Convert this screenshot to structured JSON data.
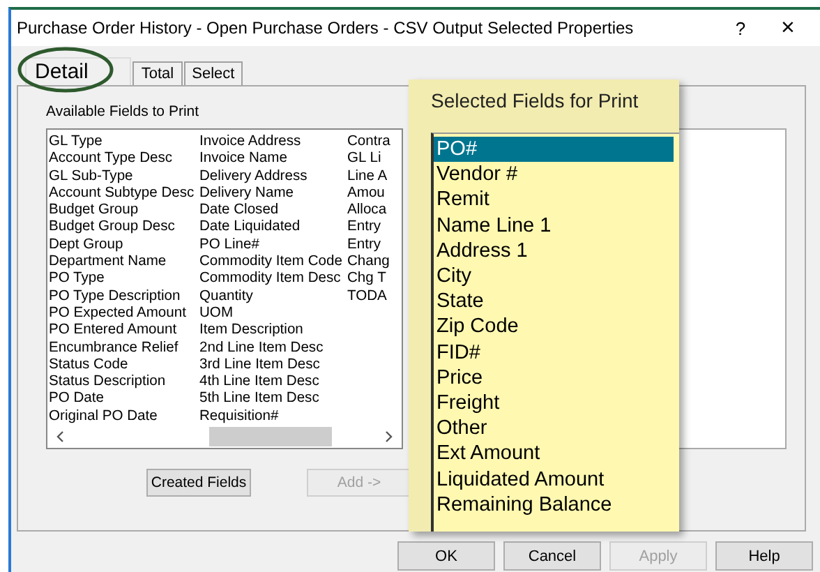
{
  "window": {
    "title": "Purchase Order History - Open Purchase Orders - CSV Output Selected Properties",
    "help_button": "?",
    "close_button": "×"
  },
  "tabs": [
    {
      "label": "Detail",
      "selected": true,
      "circled": true
    },
    {
      "label": "Total",
      "selected": false,
      "circled": false
    },
    {
      "label": "Select",
      "selected": false,
      "circled": false
    }
  ],
  "available_fields": {
    "label": "Available Fields to Print",
    "columns": [
      [
        "GL Type",
        "Account Type Desc",
        "GL Sub-Type",
        "Account Subtype Desc",
        "Budget Group",
        "Budget Group Desc",
        "Dept Group",
        "Department Name",
        "PO Type",
        "PO Type Description",
        "PO Expected Amount",
        "PO Entered Amount",
        "Encumbrance Relief",
        "Status Code",
        "Status Description",
        "PO Date",
        "Original PO Date"
      ],
      [
        "Invoice Address",
        "Invoice Name",
        "Delivery Address",
        "Delivery Name",
        "Date Closed",
        "Date Liquidated",
        "PO Line#",
        "Commodity Item Code",
        "Commodity Item Desc",
        "Quantity",
        "UOM",
        "Item Description",
        "2nd Line Item Desc",
        "3rd Line Item Desc",
        "4th Line Item Desc",
        "5th Line Item Desc",
        "Requisition#"
      ],
      [
        "Contra",
        "GL Li",
        "Line A",
        "Amou",
        "Alloca",
        "Entry",
        "Entry",
        "Chang",
        "Chg T",
        "TODA"
      ]
    ]
  },
  "selected_fields": {
    "title": "Selected Fields for Print",
    "items": [
      {
        "label": "PO#",
        "selected": true
      },
      {
        "label": "Vendor #",
        "selected": false
      },
      {
        "label": "Remit",
        "selected": false
      },
      {
        "label": "Name Line 1",
        "selected": false
      },
      {
        "label": "Address 1",
        "selected": false
      },
      {
        "label": "City",
        "selected": false
      },
      {
        "label": "State",
        "selected": false
      },
      {
        "label": "Zip Code",
        "selected": false
      },
      {
        "label": "FID#",
        "selected": false
      },
      {
        "label": "Price",
        "selected": false
      },
      {
        "label": "Freight",
        "selected": false
      },
      {
        "label": "Other",
        "selected": false
      },
      {
        "label": "Ext Amount",
        "selected": false
      },
      {
        "label": "Liquidated Amount",
        "selected": false
      },
      {
        "label": "Remaining Balance",
        "selected": false
      }
    ]
  },
  "buttons": [
    {
      "label": "Created Fields",
      "disabled": false
    },
    {
      "label": "Add ->",
      "disabled": true
    }
  ],
  "footer_buttons": [
    {
      "label": "OK",
      "disabled": false
    },
    {
      "label": "Cancel",
      "disabled": false
    },
    {
      "label": "Apply",
      "disabled": true
    },
    {
      "label": "Help",
      "disabled": false
    }
  ]
}
